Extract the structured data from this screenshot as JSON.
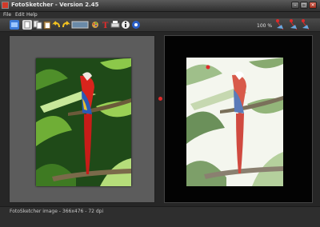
{
  "window": {
    "title": "FotoSketcher - Version 2.45"
  },
  "menu": {
    "items": [
      "File",
      "Edit",
      "Help"
    ]
  },
  "toolbar": {
    "icons": [
      "open-icon",
      "save-icon",
      "copy-icon",
      "paste-icon",
      "undo-icon",
      "redo-icon",
      "scan-icon",
      "settings-icon",
      "text-icon",
      "print-icon",
      "info-icon",
      "help-icon"
    ],
    "zoom": "100 %"
  },
  "status": {
    "text": "FotoSketcher image - 366x476 - 72 dpi"
  },
  "colors": {
    "accent": "#e02a2a",
    "panel": "#5c5c5c",
    "canvas": "#030303"
  }
}
